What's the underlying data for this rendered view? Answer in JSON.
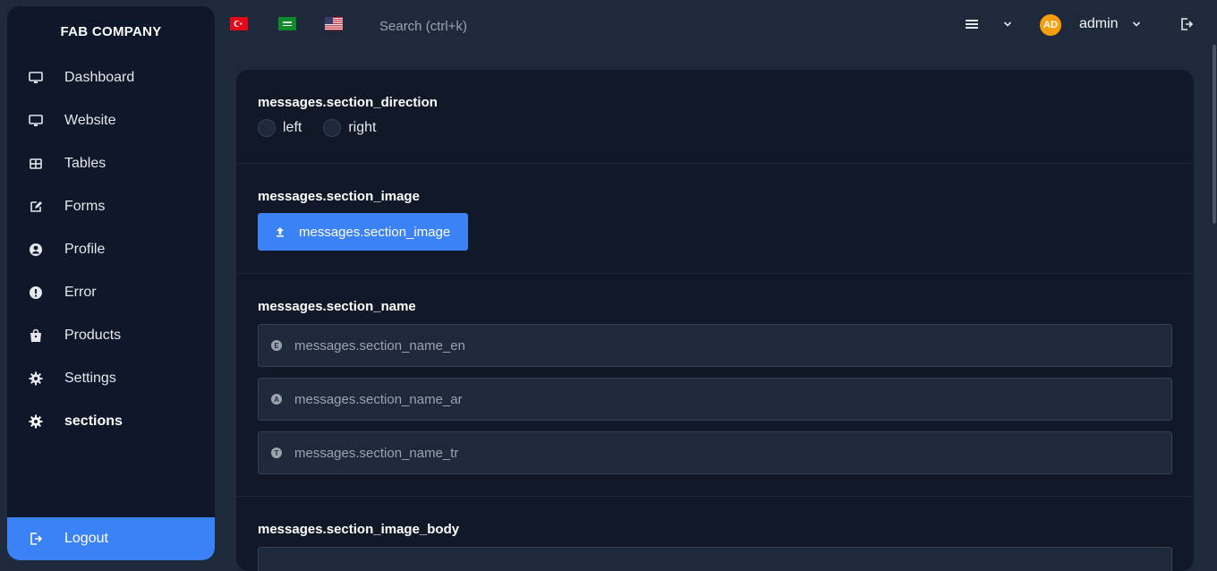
{
  "brand": "FAB COMPANY",
  "sidebar": {
    "items": [
      {
        "label": "Dashboard",
        "icon": "monitor-icon"
      },
      {
        "label": "Website",
        "icon": "monitor-icon"
      },
      {
        "label": "Tables",
        "icon": "table-icon"
      },
      {
        "label": "Forms",
        "icon": "edit-icon"
      },
      {
        "label": "Profile",
        "icon": "user-circle-icon"
      },
      {
        "label": "Error",
        "icon": "alert-circle-icon"
      },
      {
        "label": "Products",
        "icon": "shopping-bag-icon"
      },
      {
        "label": "Settings",
        "icon": "gear-icon"
      },
      {
        "label": "sections",
        "icon": "gear-icon",
        "active": true
      }
    ],
    "logout_label": "Logout"
  },
  "topbar": {
    "flags": [
      "turkey-flag-icon",
      "saudi-flag-icon",
      "usa-flag-icon"
    ],
    "search_placeholder": "Search (ctrl+k)",
    "avatar_initials": "AD",
    "user_name": "admin"
  },
  "form": {
    "direction": {
      "title": "messages.section_direction",
      "options": [
        "left",
        "right"
      ]
    },
    "image": {
      "title": "messages.section_image",
      "button_label": "messages.section_image"
    },
    "name": {
      "title": "messages.section_name",
      "fields": [
        {
          "badge": "E",
          "placeholder": "messages.section_name_en"
        },
        {
          "badge": "A",
          "placeholder": "messages.section_name_ar"
        },
        {
          "badge": "T",
          "placeholder": "messages.section_name_tr"
        }
      ]
    },
    "image_body": {
      "title": "messages.section_image_body"
    }
  },
  "colors": {
    "accent": "#3b82f6",
    "sidebar_bg": "#0f172a",
    "page_bg": "#1e293b",
    "card_bg": "#111827",
    "avatar": "#f59e0b"
  }
}
